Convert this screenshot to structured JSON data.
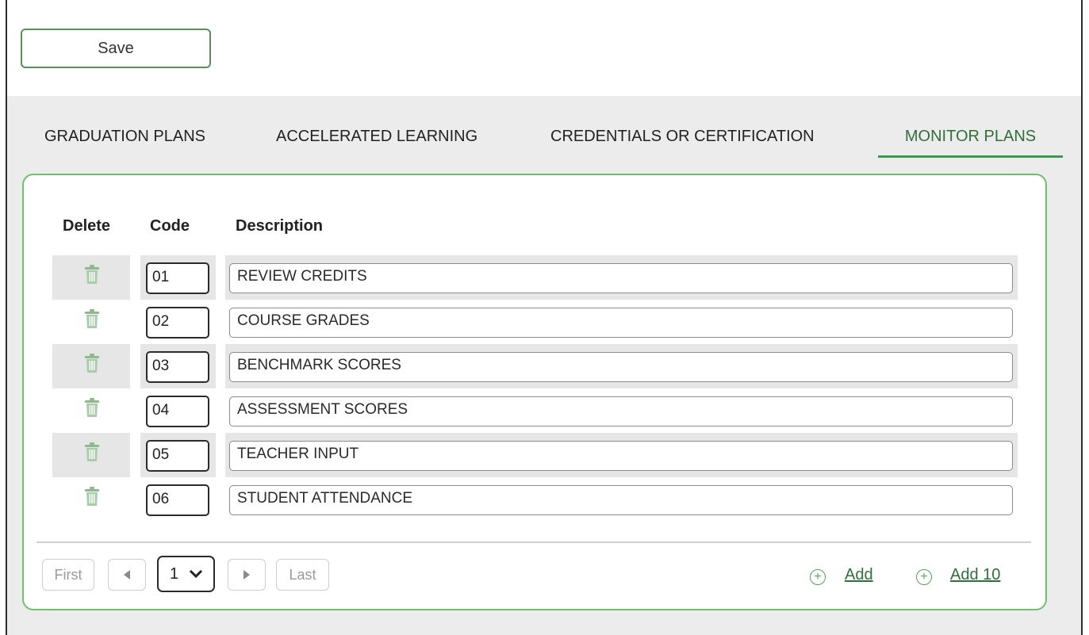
{
  "toolbar": {
    "save_label": "Save"
  },
  "tabs": [
    {
      "label": "GRADUATION PLANS",
      "active": false
    },
    {
      "label": "ACCELERATED LEARNING",
      "active": false
    },
    {
      "label": "CREDENTIALS OR CERTIFICATION",
      "active": false
    },
    {
      "label": "MONITOR PLANS",
      "active": true
    }
  ],
  "table": {
    "headers": {
      "delete": "Delete",
      "code": "Code",
      "description": "Description"
    },
    "rows": [
      {
        "code": "01",
        "description": "REVIEW CREDITS"
      },
      {
        "code": "02",
        "description": "COURSE GRADES"
      },
      {
        "code": "03",
        "description": "BENCHMARK SCORES"
      },
      {
        "code": "04",
        "description": "ASSESSMENT SCORES"
      },
      {
        "code": "05",
        "description": "TEACHER INPUT"
      },
      {
        "code": "06",
        "description": "STUDENT ATTENDANCE"
      }
    ]
  },
  "pagination": {
    "first_label": "First",
    "last_label": "Last",
    "current_page": "1"
  },
  "actions": {
    "add_label": "Add",
    "add10_label": "Add 10"
  },
  "icons": {
    "delete": "trash-icon",
    "prev": "caret-left-icon",
    "next": "caret-right-icon",
    "add": "plus-circle-icon"
  },
  "colors": {
    "accent": "#3a9a4a",
    "card_border": "#6cc36c",
    "icon_green": "#5aa05a"
  }
}
